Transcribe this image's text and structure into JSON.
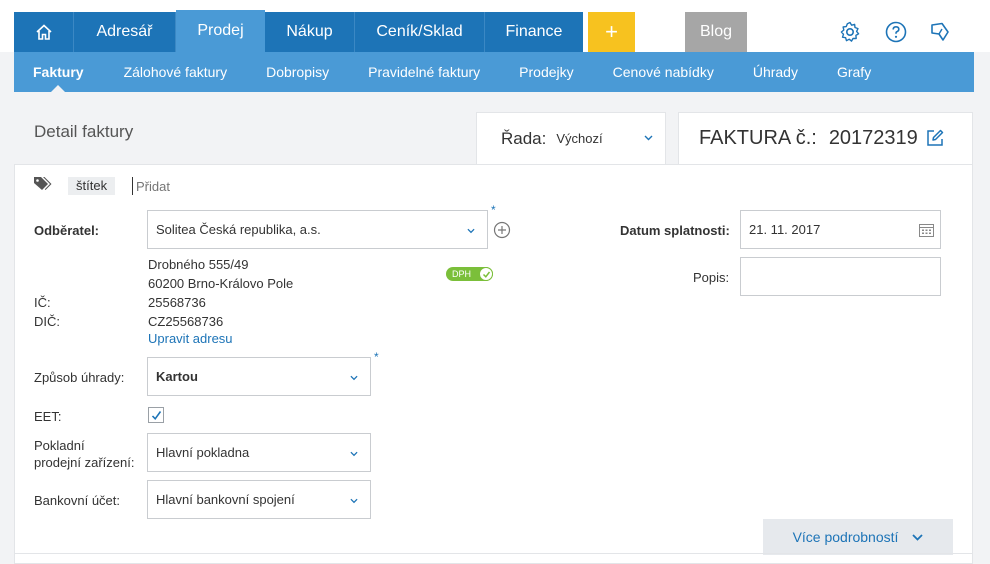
{
  "top_nav": {
    "tabs": [
      {
        "label": "Adresář"
      },
      {
        "label": "Prodej"
      },
      {
        "label": "Nákup"
      },
      {
        "label": "Ceník/Sklad"
      },
      {
        "label": "Finance"
      }
    ],
    "active_tab": "Prodej",
    "add_button": "+",
    "blog": "Blog",
    "icons": [
      "home-icon",
      "settings-gear-icon",
      "help-icon",
      "feedback-icon"
    ],
    "colors": {
      "primary": "#1d74b7",
      "active": "#4a9ad6",
      "add": "#f7c21f",
      "blog": "#a6a6a6"
    }
  },
  "sub_nav": {
    "items": [
      {
        "label": "Faktury"
      },
      {
        "label": "Zálohové faktury"
      },
      {
        "label": "Dobropisy"
      },
      {
        "label": "Pravidelné faktury"
      },
      {
        "label": "Prodejky"
      },
      {
        "label": "Cenové nabídky"
      },
      {
        "label": "Úhrady"
      },
      {
        "label": "Grafy"
      }
    ],
    "active_item": "Faktury"
  },
  "page": {
    "title": "Detail faktury",
    "rada_label": "Řada:",
    "rada_value": "Výchozí",
    "faktura_label": "FAKTURA č.:",
    "faktura_number": "20172319"
  },
  "tags": {
    "chip": "štítek",
    "placeholder": "Přidat"
  },
  "form": {
    "odberatel_label": "Odběratel:",
    "odberatel_value": "Solitea Česká republika, a.s.",
    "required_mark": "*",
    "address_line1": "Drobného 555/49",
    "address_line2": "60200 Brno-Královo Pole",
    "dph_badge": "DPH",
    "ic_label": "IČ:",
    "ic_value": "25568736",
    "dic_label": "DIČ:",
    "dic_value": "CZ25568736",
    "edit_address": "Upravit adresu",
    "zpusob_uhrady_label": "Způsob úhrady:",
    "zpusob_uhrady_value": "Kartou",
    "eet_label": "EET:",
    "eet_checked": true,
    "pokladni_label_1": "Pokladní",
    "pokladni_label_2": "prodejní zařízení:",
    "pokladni_value": "Hlavní pokladna",
    "bankovni_label": "Bankovní účet:",
    "bankovni_value": "Hlavní bankovní spojení",
    "datum_splatnosti_label": "Datum splatnosti:",
    "datum_splatnosti_value": "21. 11. 2017",
    "popis_label": "Popis:",
    "popis_value": ""
  },
  "more_button": "Více podrobností"
}
